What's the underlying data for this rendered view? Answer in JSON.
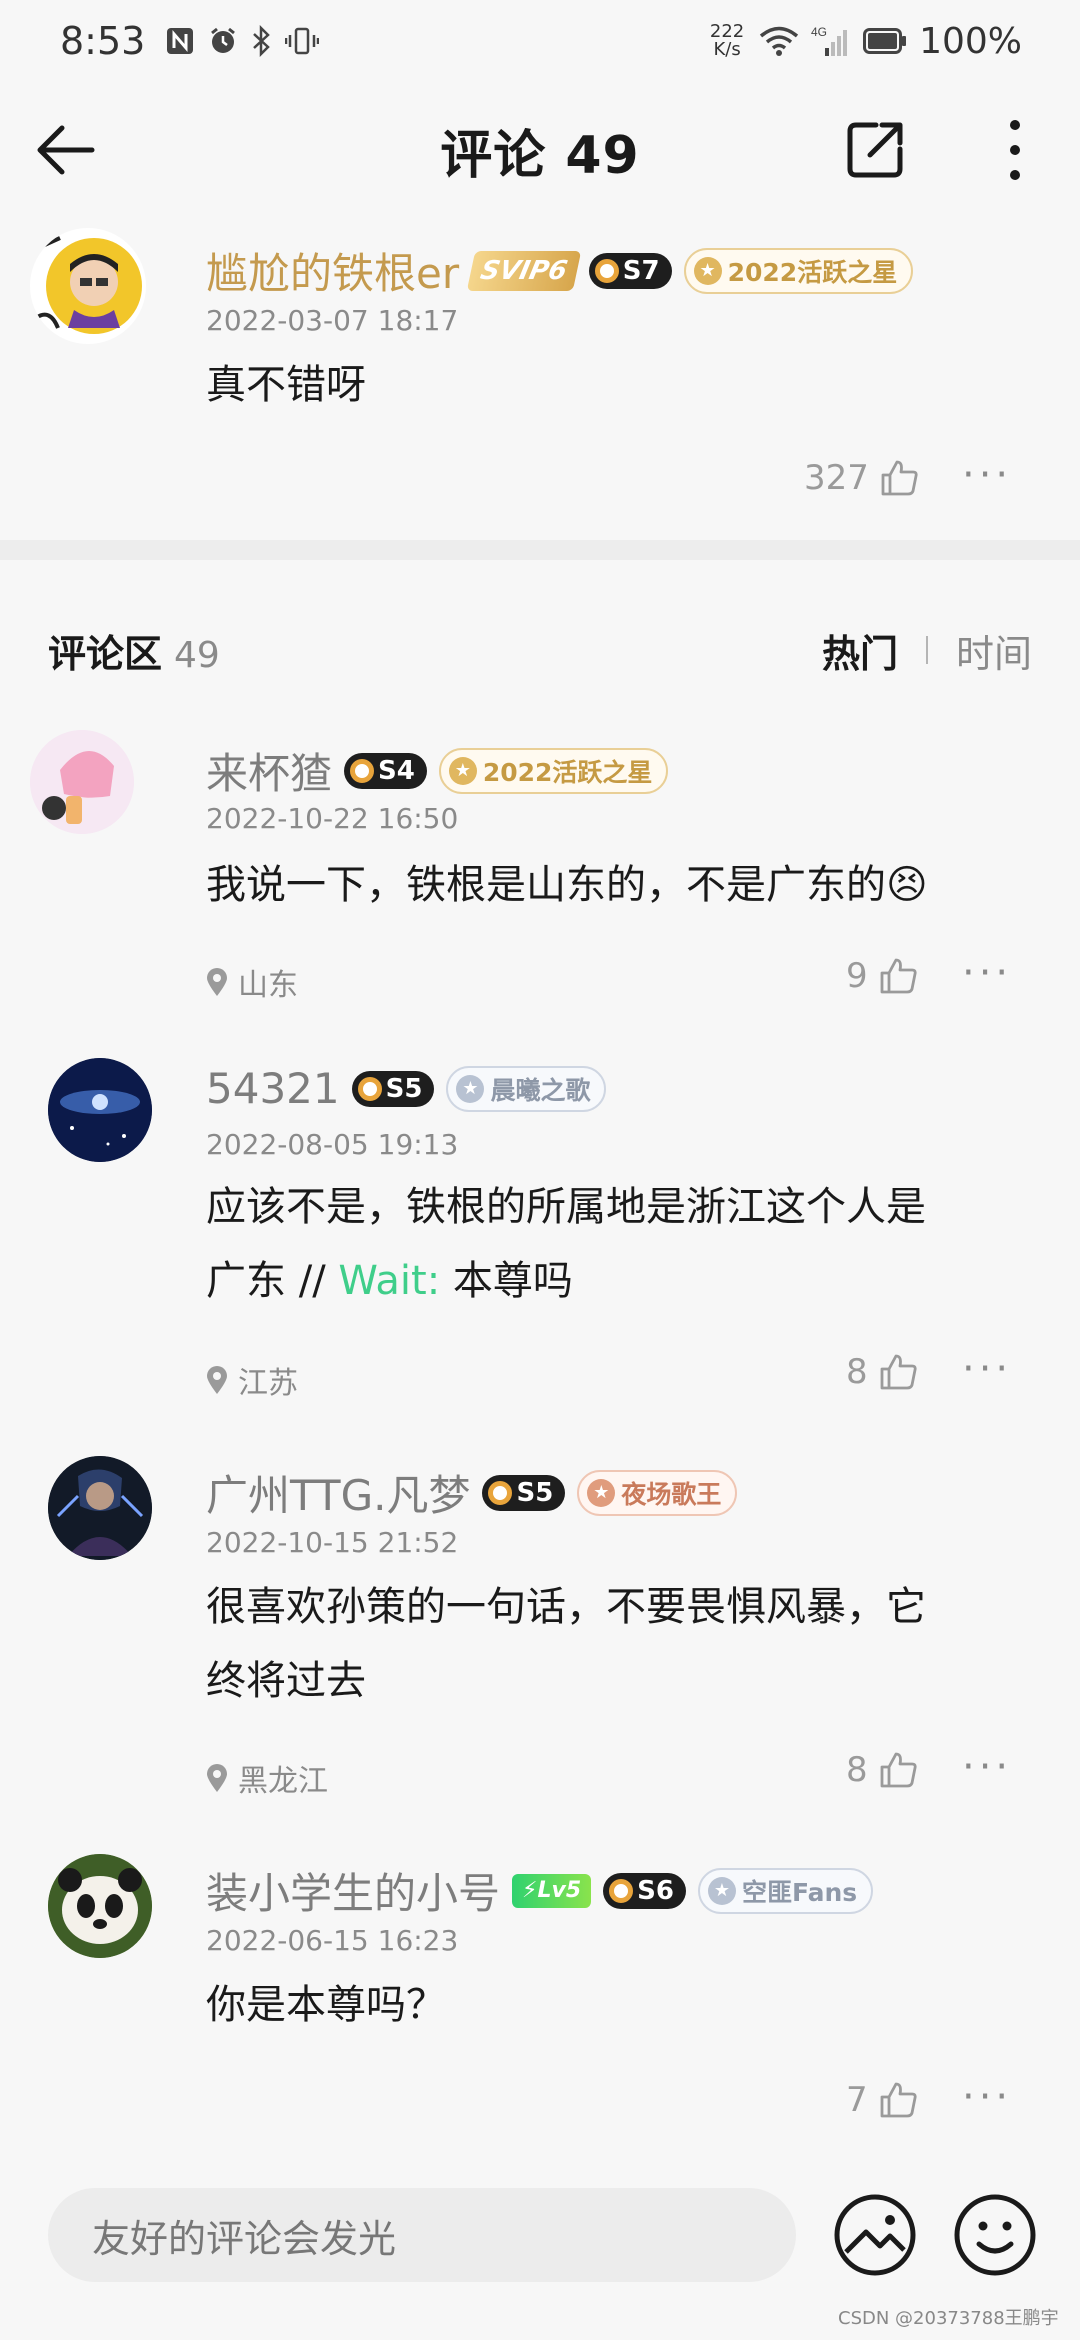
{
  "status_bar": {
    "time": "8:53",
    "net_speed_value": "222",
    "net_speed_unit": "K/s",
    "signal_label": "4G",
    "battery": "100%"
  },
  "header": {
    "title": "评论 49",
    "back_icon": "arrow-left-icon",
    "share_icon": "share-icon",
    "more_icon": "more-vertical-icon"
  },
  "main_comment": {
    "username": "尴尬的铁根er",
    "vip_badge": "SVIP6",
    "level_badge": "S7",
    "title_badge": "2022活跃之星",
    "date": "2022-03-07 18:17",
    "text": "真不错呀",
    "likes": "327"
  },
  "section": {
    "title": "评论区",
    "count": "49",
    "sort_hot": "热门",
    "sort_time": "时间"
  },
  "comments": [
    {
      "username": "来杯猹",
      "level_badge": "S4",
      "title_badge": "2022活跃之星",
      "date": "2022-10-22 16:50",
      "text": "我说一下，铁根是山东的，不是广东的😣",
      "location": "山东",
      "likes": "9"
    },
    {
      "username": "54321",
      "level_badge": "S5",
      "title_badge": "晨曦之歌",
      "date": "2022-08-05 19:13",
      "text_line1": "应该不是，铁根的所属地是浙江这个人是",
      "text_line2_prefix": "广东 // ",
      "reply_name": "Wait:",
      "text_line2_suffix": " 本尊吗",
      "location": "江苏",
      "likes": "8"
    },
    {
      "username": "广州TTG.凡梦",
      "level_badge": "S5",
      "title_badge": "夜场歌王",
      "date": "2022-10-15 21:52",
      "text_line1": "很喜欢孙策的一句话，不要畏惧风暴，它",
      "text_line2": "终将过去",
      "location": "黑龙江",
      "likes": "8"
    },
    {
      "username": "装小学生的小号",
      "lv_badge": "Lv5",
      "level_badge": "S6",
      "title_badge": "空匪Fans",
      "date": "2022-06-15 16:23",
      "text": "你是本尊吗？",
      "likes": "7"
    }
  ],
  "input": {
    "placeholder": "友好的评论会发光"
  },
  "watermark": "CSDN @20373788王鹏宇",
  "colors": {
    "gold_name": "#c49a4e",
    "reply_name": "#3fce8a",
    "gray_text": "#8a8a8a"
  }
}
